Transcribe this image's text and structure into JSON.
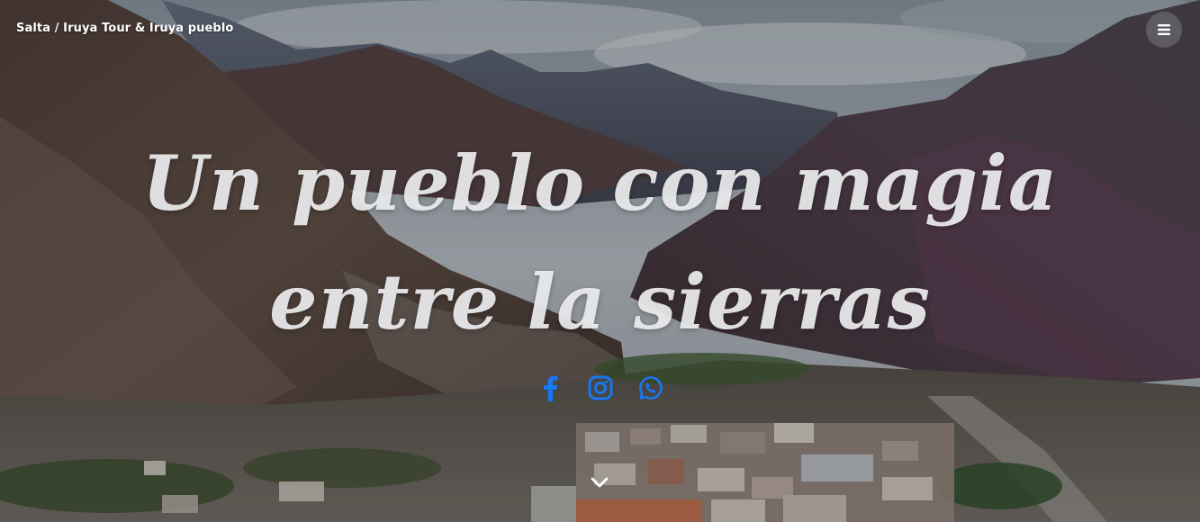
{
  "header": {
    "brand": "Salta / Iruya Tour & Iruya pueblo",
    "menu_icon": "bars-icon"
  },
  "hero": {
    "headline_line1": "Un pueblo con magia",
    "headline_line2": "entre la sierras",
    "background": "mountain-valley-village-photo"
  },
  "social": {
    "items": [
      {
        "name": "facebook",
        "icon": "facebook-icon"
      },
      {
        "name": "instagram",
        "icon": "instagram-icon"
      },
      {
        "name": "whatsapp",
        "icon": "whatsapp-icon"
      }
    ],
    "color": "#1877f2"
  },
  "scroll": {
    "icon": "chevron-down-icon"
  }
}
